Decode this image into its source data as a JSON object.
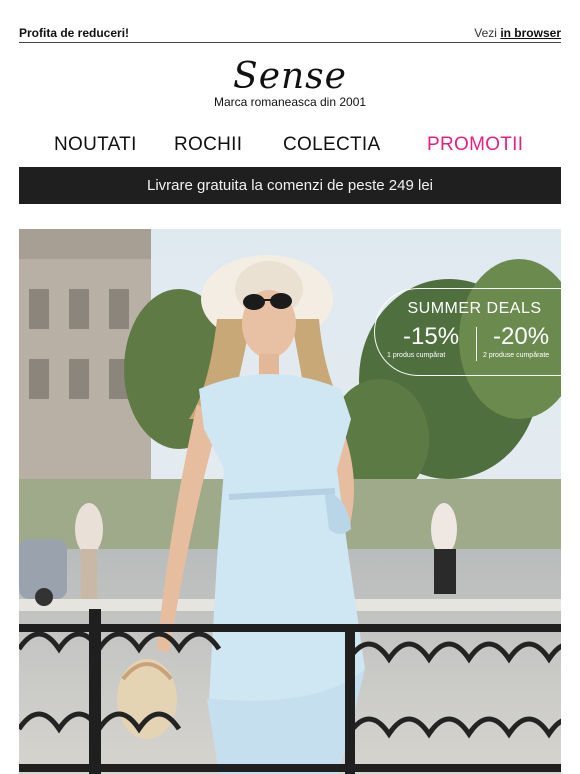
{
  "topbar": {
    "left_text": "Profita de reduceri!",
    "right_prefix": "Vezi",
    "right_link": "in browser"
  },
  "brand": {
    "logo": "Sense",
    "tagline": "Marca romaneasca din 2001"
  },
  "nav": {
    "items": [
      "NOUTATI",
      "ROCHII",
      "COLECTIA",
      "PROMOTII"
    ]
  },
  "banner": {
    "text": "Livrare gratuita la comenzi de peste 249 lei"
  },
  "hero": {
    "deals_title": "SUMMER DEALS",
    "discount_1": "-15%",
    "discount_1_sub": "1 produs cumpărat",
    "discount_2": "-20%",
    "discount_2_sub": "2 produse cumpărate"
  },
  "colors": {
    "promo": "#e6207f",
    "banner_bg": "#1f1f1f",
    "dress": "#cfe6f3"
  }
}
